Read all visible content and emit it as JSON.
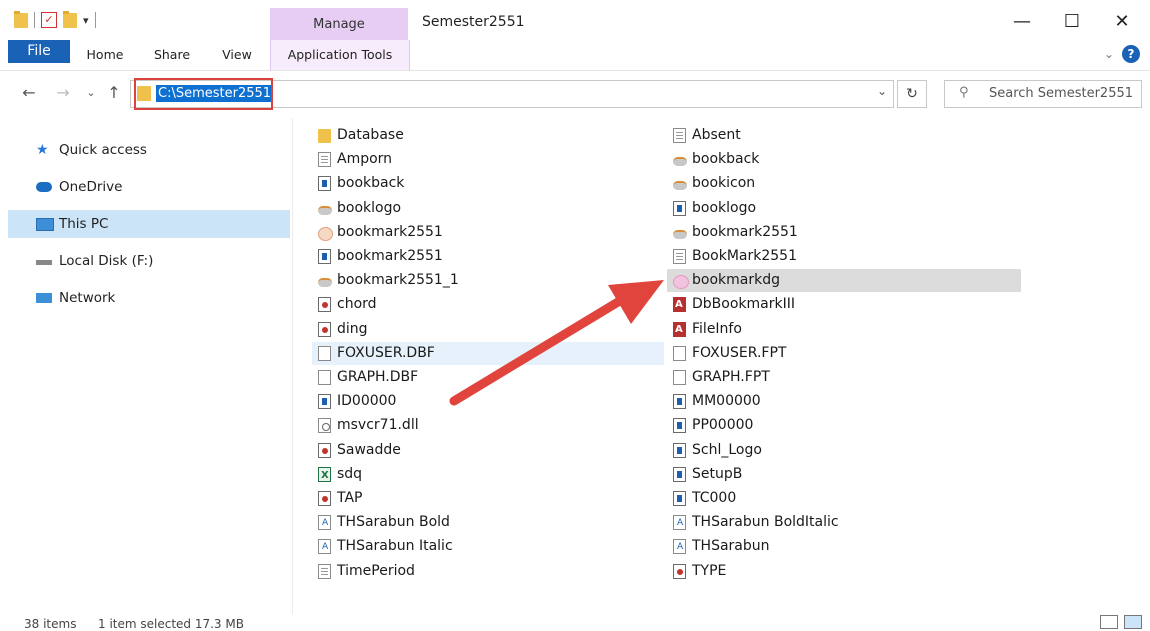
{
  "window": {
    "title": "Semester2551",
    "manage_label": "Manage",
    "controls": {
      "minimize": "—",
      "maximize": "☐",
      "close": "✕"
    }
  },
  "ribbon": {
    "tabs": [
      "File",
      "Home",
      "Share",
      "View",
      "Application Tools"
    ]
  },
  "address": {
    "path": "C:\\Semester2551",
    "search_placeholder": "Search Semester2551"
  },
  "sidebar": {
    "items": [
      {
        "label": "Quick access",
        "icon": "star-icon"
      },
      {
        "label": "OneDrive",
        "icon": "cloud-icon"
      },
      {
        "label": "This PC",
        "icon": "computer-icon",
        "selected": true
      },
      {
        "label": "Local Disk (F:)",
        "icon": "drive-icon"
      },
      {
        "label": "Network",
        "icon": "network-icon"
      }
    ]
  },
  "files": {
    "col1": [
      {
        "name": "Database",
        "icon": "folder"
      },
      {
        "name": "Amporn",
        "icon": "doc"
      },
      {
        "name": "bookback",
        "icon": "img"
      },
      {
        "name": "booklogo",
        "icon": "cloud"
      },
      {
        "name": "bookmark2551",
        "icon": "flower"
      },
      {
        "name": "bookmark2551",
        "icon": "img"
      },
      {
        "name": "bookmark2551_1",
        "icon": "cloud"
      },
      {
        "name": "chord",
        "icon": "red"
      },
      {
        "name": "ding",
        "icon": "red"
      },
      {
        "name": "FOXUSER.DBF",
        "icon": "blank",
        "highlight": "light"
      },
      {
        "name": "GRAPH.DBF",
        "icon": "blank"
      },
      {
        "name": "ID00000",
        "icon": "img"
      },
      {
        "name": "msvcr71.dll",
        "icon": "dll"
      },
      {
        "name": "Sawadde",
        "icon": "red"
      },
      {
        "name": "sdq",
        "icon": "excel"
      },
      {
        "name": "TAP",
        "icon": "red"
      },
      {
        "name": "THSarabun Bold",
        "icon": "font"
      },
      {
        "name": "THSarabun Italic",
        "icon": "font"
      },
      {
        "name": "TimePeriod",
        "icon": "doc"
      }
    ],
    "col2": [
      {
        "name": "Absent",
        "icon": "doc"
      },
      {
        "name": "bookback",
        "icon": "cloud"
      },
      {
        "name": "bookicon",
        "icon": "cloud"
      },
      {
        "name": "booklogo",
        "icon": "img"
      },
      {
        "name": "bookmark2551",
        "icon": "cloud"
      },
      {
        "name": "BookMark2551",
        "icon": "doc"
      },
      {
        "name": "bookmarkdg",
        "icon": "pink",
        "highlight": "selected"
      },
      {
        "name": "DbBookmarkIII",
        "icon": "access"
      },
      {
        "name": "FileInfo",
        "icon": "access"
      },
      {
        "name": "FOXUSER.FPT",
        "icon": "blank"
      },
      {
        "name": "GRAPH.FPT",
        "icon": "blank"
      },
      {
        "name": "MM00000",
        "icon": "img"
      },
      {
        "name": "PP00000",
        "icon": "img"
      },
      {
        "name": "Schl_Logo",
        "icon": "img"
      },
      {
        "name": "SetupB",
        "icon": "img"
      },
      {
        "name": "TC000",
        "icon": "img"
      },
      {
        "name": "THSarabun BoldItalic",
        "icon": "font"
      },
      {
        "name": "THSarabun",
        "icon": "font"
      },
      {
        "name": "TYPE",
        "icon": "red"
      }
    ]
  },
  "status": {
    "count": "38 items",
    "selection": "1 item selected  17.3 MB"
  },
  "colors": {
    "accent": "#1a62b6",
    "manage_tab": "#e7cdf4",
    "selection": "#cce4f7",
    "annotation_red": "#d9433b"
  }
}
